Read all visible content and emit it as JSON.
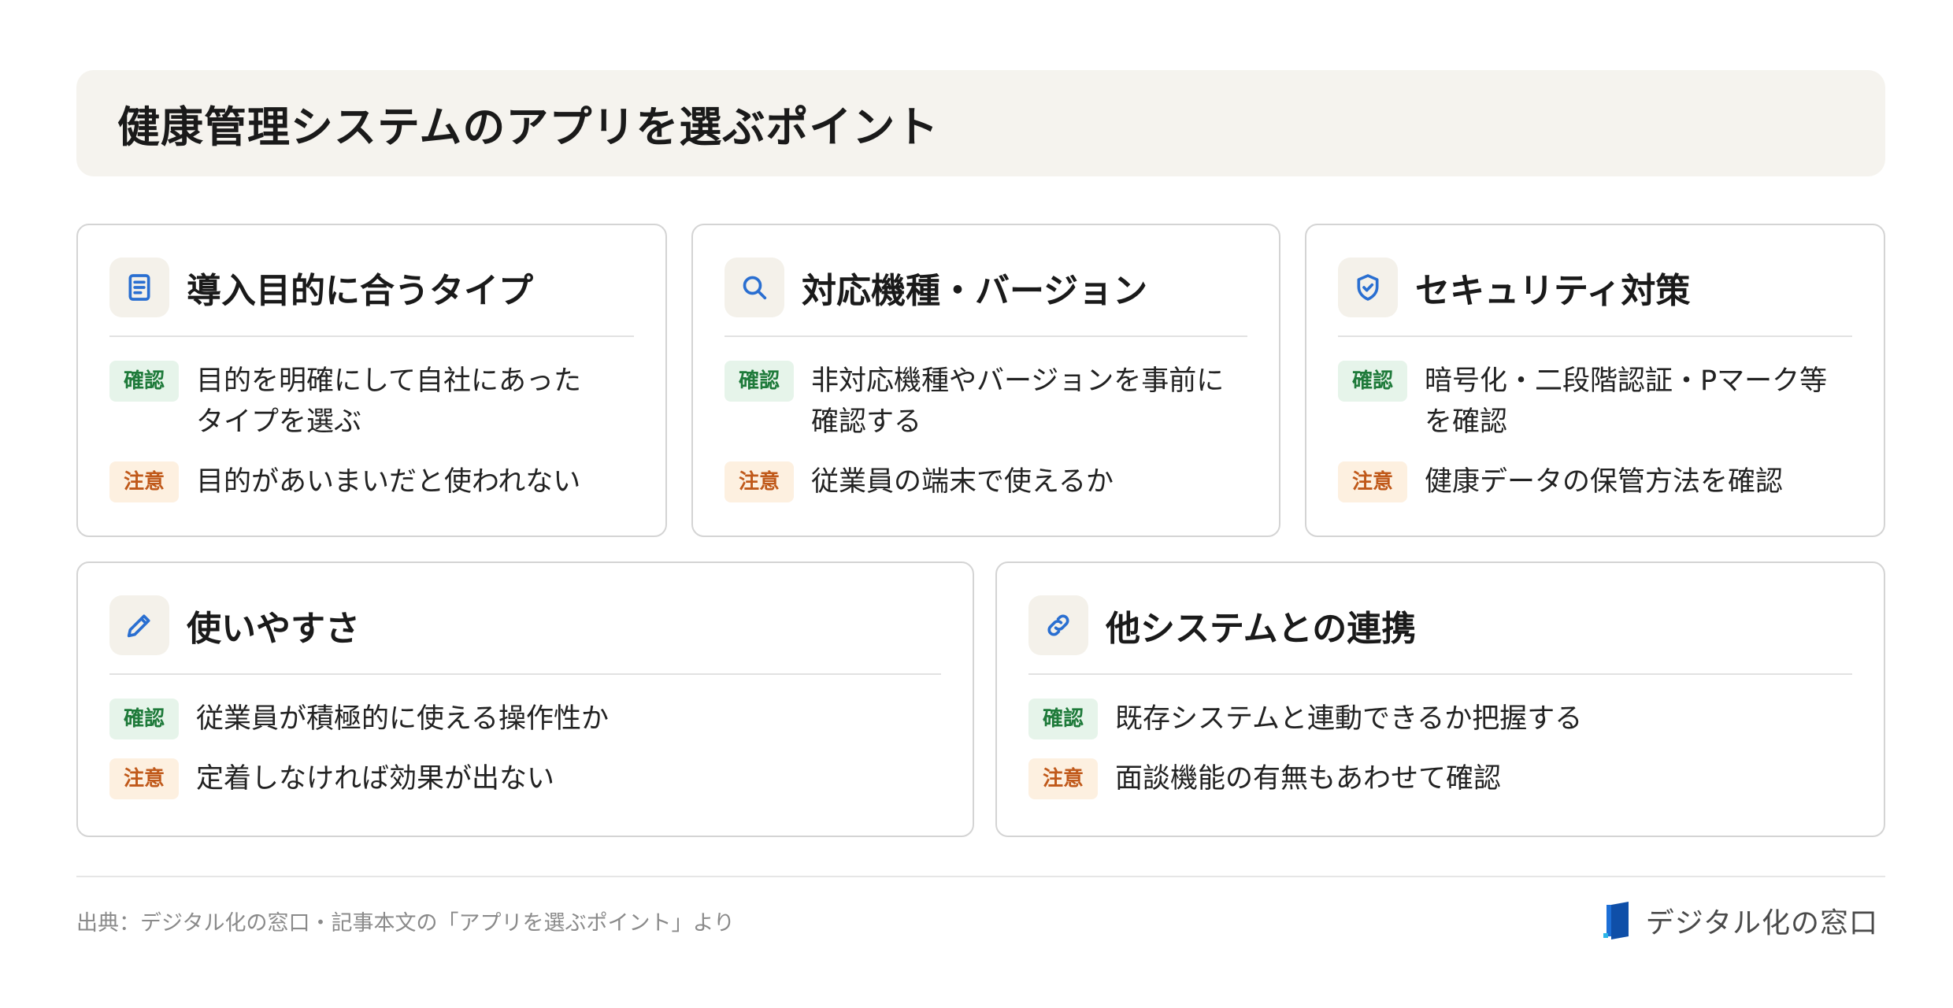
{
  "title": "健康管理システムのアプリを選ぶポイント",
  "cards": [
    {
      "icon": "document-icon",
      "title": "導入目的に合うタイプ",
      "confirm_label": "確認",
      "confirm_text": "目的を明確にして自社にあったタイプを選ぶ",
      "caution_label": "注意",
      "caution_text": "目的があいまいだと使われない"
    },
    {
      "icon": "search-icon",
      "title": "対応機種・バージョン",
      "confirm_label": "確認",
      "confirm_text": "非対応機種やバージョンを事前に確認する",
      "caution_label": "注意",
      "caution_text": "従業員の端末で使えるか"
    },
    {
      "icon": "shield-check-icon",
      "title": "セキュリティ対策",
      "confirm_label": "確認",
      "confirm_text": "暗号化・二段階認証・Pマーク等を確認",
      "caution_label": "注意",
      "caution_text": "健康データの保管方法を確認"
    },
    {
      "icon": "pencil-icon",
      "title": "使いやすさ",
      "confirm_label": "確認",
      "confirm_text": "従業員が積極的に使える操作性か",
      "caution_label": "注意",
      "caution_text": "定着しなければ効果が出ない"
    },
    {
      "icon": "link-icon",
      "title": "他システムとの連携",
      "confirm_label": "確認",
      "confirm_text": "既存システムと連動できるか把握する",
      "caution_label": "注意",
      "caution_text": "面談機能の有無もあわせて確認"
    }
  ],
  "colors": {
    "confirm_badge_bg": "#e6f4ea",
    "confirm_badge_text": "#1e7a3a",
    "caution_badge_bg": "#fdf0e0",
    "caution_badge_text": "#c0591a",
    "icon_stroke": "#2a6fd1",
    "banner_bg": "#f5f3ee"
  },
  "footer": {
    "source": "出典：デジタル化の窓口・記事本文の「アプリを選ぶポイント」より",
    "brand_name": "デジタル化の窓口",
    "brand_icon": "door-logo-icon"
  }
}
